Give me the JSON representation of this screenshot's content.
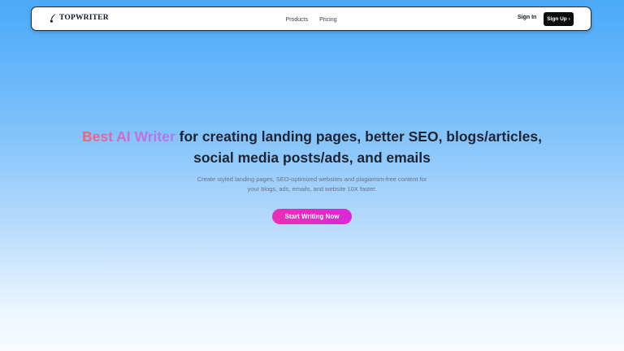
{
  "header": {
    "logo_text": "TOPWRITER",
    "nav": [
      {
        "label": "Products"
      },
      {
        "label": "Pricing"
      }
    ],
    "sign_in_label": "Sign In",
    "sign_up_label": "Sign Up",
    "sign_up_arrow": "›"
  },
  "hero": {
    "headline_accent": "Best AI Writer",
    "headline_rest": " for creating landing pages, better SEO, blogs/articles, social media posts/ads, and emails",
    "subtext": "Create styled landing pages, SEO-optimized websites and plagiarism-free content for your blogs, ads, emails, and website 10X faster.",
    "cta_label": "Start Writing Now"
  },
  "colors": {
    "cta_start": "#ec2fb7",
    "cta_end": "#d729d9",
    "accent_start": "#f06477",
    "accent_end": "#a77cf0",
    "background_top": "#4aa9f8",
    "background_bottom": "#f7fbff"
  },
  "icons": {
    "logo": "quill-pen-icon"
  }
}
